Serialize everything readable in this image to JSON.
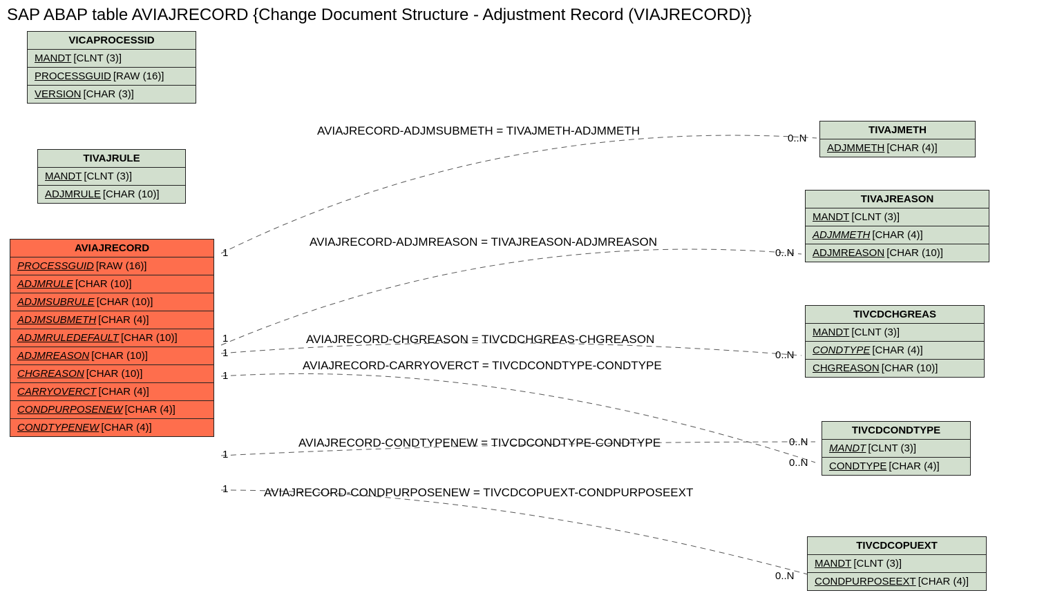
{
  "title": "SAP ABAP table AVIAJRECORD {Change Document Structure - Adjustment Record (VIAJRECORD)}",
  "entities": {
    "vicaprocessid": {
      "name": "VICAPROCESSID",
      "rows": [
        {
          "field": "MANDT",
          "type": "[CLNT (3)]",
          "italic": false
        },
        {
          "field": "PROCESSGUID",
          "type": "[RAW (16)]",
          "italic": false
        },
        {
          "field": "VERSION",
          "type": "[CHAR (3)]",
          "italic": false
        }
      ]
    },
    "tivajrule": {
      "name": "TIVAJRULE",
      "rows": [
        {
          "field": "MANDT",
          "type": "[CLNT (3)]",
          "italic": false
        },
        {
          "field": "ADJMRULE",
          "type": "[CHAR (10)]",
          "italic": false
        }
      ]
    },
    "aviajrecord": {
      "name": "AVIAJRECORD",
      "rows": [
        {
          "field": "PROCESSGUID",
          "type": "[RAW (16)]",
          "italic": true
        },
        {
          "field": "ADJMRULE",
          "type": "[CHAR (10)]",
          "italic": true
        },
        {
          "field": "ADJMSUBRULE",
          "type": "[CHAR (10)]",
          "italic": true
        },
        {
          "field": "ADJMSUBMETH",
          "type": "[CHAR (4)]",
          "italic": true
        },
        {
          "field": "ADJMRULEDEFAULT",
          "type": "[CHAR (10)]",
          "italic": true
        },
        {
          "field": "ADJMREASON",
          "type": "[CHAR (10)]",
          "italic": true
        },
        {
          "field": "CHGREASON",
          "type": "[CHAR (10)]",
          "italic": true
        },
        {
          "field": "CARRYOVERCT",
          "type": "[CHAR (4)]",
          "italic": true
        },
        {
          "field": "CONDPURPOSENEW",
          "type": "[CHAR (4)]",
          "italic": true
        },
        {
          "field": "CONDTYPENEW",
          "type": "[CHAR (4)]",
          "italic": true
        }
      ]
    },
    "tivajmeth": {
      "name": "TIVAJMETH",
      "rows": [
        {
          "field": "ADJMMETH",
          "type": "[CHAR (4)]",
          "italic": false
        }
      ]
    },
    "tivajreason": {
      "name": "TIVAJREASON",
      "rows": [
        {
          "field": "MANDT",
          "type": "[CLNT (3)]",
          "italic": false
        },
        {
          "field": "ADJMMETH",
          "type": "[CHAR (4)]",
          "italic": true
        },
        {
          "field": "ADJMREASON",
          "type": "[CHAR (10)]",
          "italic": false
        }
      ]
    },
    "tivcdchgreas": {
      "name": "TIVCDCHGREAS",
      "rows": [
        {
          "field": "MANDT",
          "type": "[CLNT (3)]",
          "italic": false
        },
        {
          "field": "CONDTYPE",
          "type": "[CHAR (4)]",
          "italic": true
        },
        {
          "field": "CHGREASON",
          "type": "[CHAR (10)]",
          "italic": false
        }
      ]
    },
    "tivcdcondtype": {
      "name": "TIVCDCONDTYPE",
      "rows": [
        {
          "field": "MANDT",
          "type": "[CLNT (3)]",
          "italic": true
        },
        {
          "field": "CONDTYPE",
          "type": "[CHAR (4)]",
          "italic": false
        }
      ]
    },
    "tivcdcopuext": {
      "name": "TIVCDCOPUEXT",
      "rows": [
        {
          "field": "MANDT",
          "type": "[CLNT (3)]",
          "italic": false
        },
        {
          "field": "CONDPURPOSEEXT",
          "type": "[CHAR (4)]",
          "italic": false
        }
      ]
    }
  },
  "relations": {
    "r1": {
      "label": "AVIAJRECORD-ADJMSUBMETH = TIVAJMETH-ADJMMETH",
      "left": "1",
      "right": "0..N"
    },
    "r2": {
      "label": "AVIAJRECORD-ADJMREASON = TIVAJREASON-ADJMREASON",
      "left": "1",
      "right": "0..N"
    },
    "r3": {
      "label": "AVIAJRECORD-CHGREASON = TIVCDCHGREAS-CHGREASON",
      "left": "1",
      "right": "0..N"
    },
    "r4": {
      "label": "AVIAJRECORD-CARRYOVERCT = TIVCDCONDTYPE-CONDTYPE",
      "left": "1",
      "right": "0..N"
    },
    "r5": {
      "label": "AVIAJRECORD-CONDTYPENEW = TIVCDCONDTYPE-CONDTYPE",
      "left": "1",
      "right": "0..N"
    },
    "r6": {
      "label": "AVIAJRECORD-CONDPURPOSENEW = TIVCDCOPUEXT-CONDPURPOSEEXT",
      "left": "1",
      "right": "0..N"
    }
  }
}
